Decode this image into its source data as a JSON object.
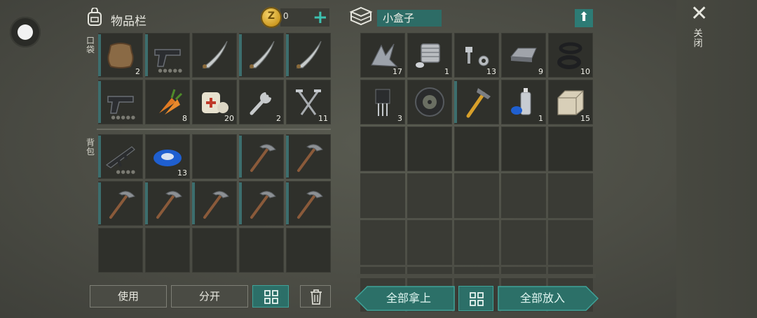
{
  "inventory": {
    "title": "物品栏",
    "pocket_label": "口袋",
    "backpack_label": "背包",
    "coins": "0",
    "coin_symbol": "Z",
    "add_symbol": "+",
    "pocket_items": [
      {
        "name": "leather-hide",
        "icon": "hide",
        "count": "2"
      },
      {
        "name": "pistol",
        "icon": "pistol",
        "count": "",
        "dots": "●●●●●"
      },
      {
        "name": "machete",
        "icon": "blade",
        "count": ""
      },
      {
        "name": "machete",
        "icon": "blade",
        "count": ""
      },
      {
        "name": "machete",
        "icon": "blade",
        "count": ""
      },
      {
        "name": "pistol",
        "icon": "pistol",
        "count": "",
        "dots": "●●●●●"
      },
      {
        "name": "carrot",
        "icon": "carrot",
        "count": "8"
      },
      {
        "name": "bandage",
        "icon": "bandage",
        "count": "20"
      },
      {
        "name": "wrench",
        "icon": "wrench",
        "count": "2"
      },
      {
        "name": "nails",
        "icon": "nails",
        "count": "11"
      }
    ],
    "backpack_items": [
      {
        "name": "assault-rifle",
        "icon": "rifle",
        "count": "",
        "dots": "●●●●"
      },
      {
        "name": "duct-tape",
        "icon": "tape",
        "count": "13"
      },
      {
        "name": "empty",
        "icon": "",
        "count": ""
      },
      {
        "name": "pickaxe",
        "icon": "pickaxe",
        "count": ""
      },
      {
        "name": "pickaxe",
        "icon": "pickaxe",
        "count": ""
      },
      {
        "name": "pickaxe",
        "icon": "pickaxe",
        "count": ""
      },
      {
        "name": "pickaxe",
        "icon": "pickaxe",
        "count": ""
      },
      {
        "name": "pickaxe",
        "icon": "pickaxe",
        "count": ""
      },
      {
        "name": "pickaxe",
        "icon": "pickaxe",
        "count": ""
      },
      {
        "name": "pickaxe",
        "icon": "pickaxe",
        "count": ""
      },
      {
        "name": "empty",
        "icon": "",
        "count": ""
      },
      {
        "name": "empty",
        "icon": "",
        "count": ""
      },
      {
        "name": "empty",
        "icon": "",
        "count": ""
      },
      {
        "name": "empty",
        "icon": "",
        "count": ""
      },
      {
        "name": "empty",
        "icon": "",
        "count": ""
      }
    ]
  },
  "box": {
    "title": "小盒子",
    "items": [
      {
        "name": "scrap-metal",
        "icon": "scrap",
        "count": "17"
      },
      {
        "name": "engine-part",
        "icon": "engine",
        "count": "1"
      },
      {
        "name": "bolts",
        "icon": "bolts",
        "count": "13"
      },
      {
        "name": "iron-ingot",
        "icon": "ingot",
        "count": "9"
      },
      {
        "name": "rubber-rings",
        "icon": "rings",
        "count": "10"
      },
      {
        "name": "transistor",
        "icon": "chip",
        "count": "3"
      },
      {
        "name": "wheel",
        "icon": "wheel",
        "count": ""
      },
      {
        "name": "hammer",
        "icon": "hammer",
        "count": ""
      },
      {
        "name": "spray-can",
        "icon": "spray",
        "count": "1"
      },
      {
        "name": "stone-block",
        "icon": "stone",
        "count": "15"
      }
    ]
  },
  "close_label": "关闭",
  "buttons": {
    "use": "使用",
    "split": "分开",
    "take_all": "全部拿上",
    "put_all": "全部放入"
  },
  "colors": {
    "accent": "#2c6f68",
    "slot": "#2f302b",
    "background": "#4b4c44"
  }
}
